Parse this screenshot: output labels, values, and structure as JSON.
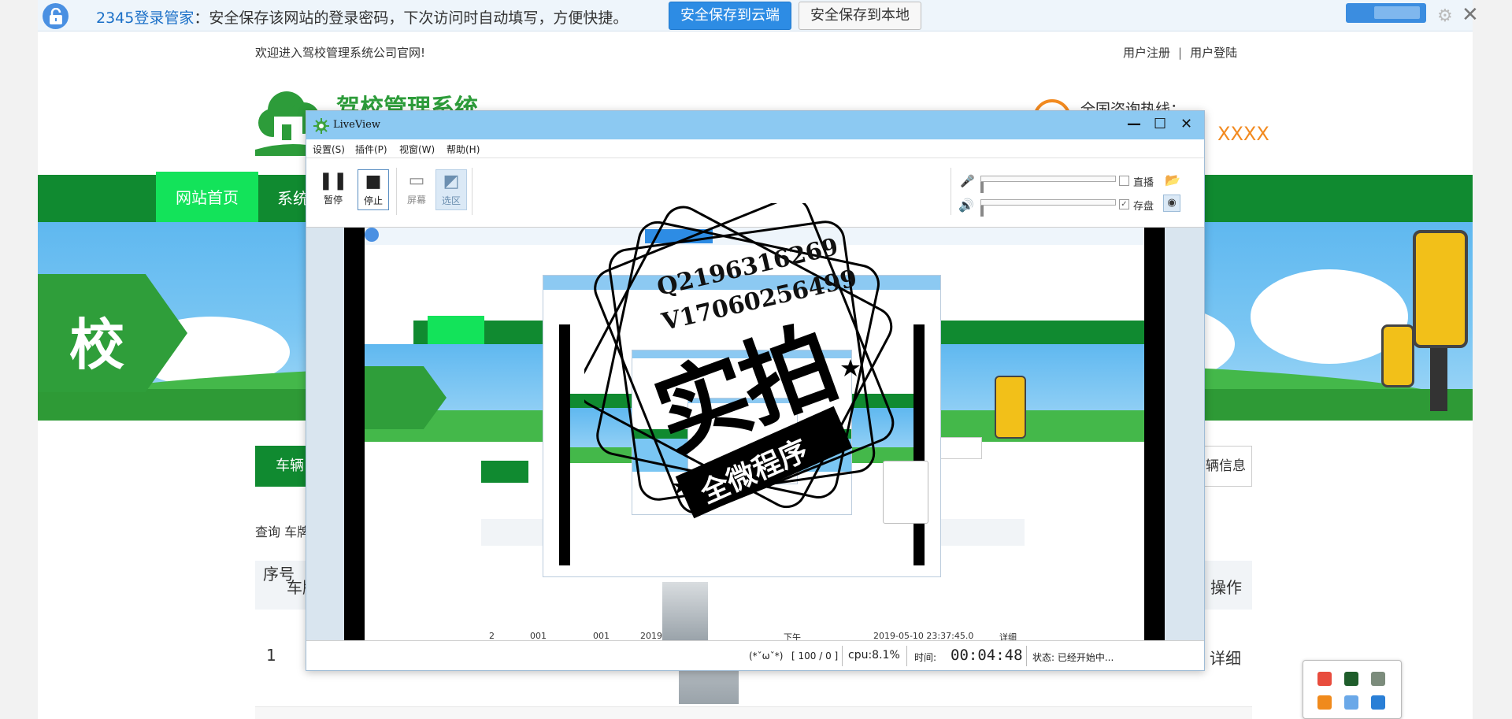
{
  "password_bar": {
    "brand": "2345登录管家",
    "message": "：安全保存该网站的登录密码，下次访问时自动填写，方便快捷。",
    "cloud_button": "安全保存到云端",
    "local_button": "安全保存到本地"
  },
  "site": {
    "welcome": "欢迎进入驾校管理系统公司官网!",
    "register": "用户注册",
    "login": "用户登陆",
    "logo_title": "驾校管理系统",
    "hotline_label": "全国咨询热线：",
    "hotline_number": "XXXX",
    "nav_home": "网站首页",
    "nav_2": "系统",
    "banner_text": "校",
    "category_button": "车辆",
    "info_button": "辆信息",
    "query_text": "查询 车牌",
    "table": {
      "col_index": "序号",
      "col_plate": "车牌",
      "col_action": "操作",
      "row1_index": "1",
      "row1_action": "详细"
    }
  },
  "liveview": {
    "title": "LiveView",
    "window_buttons": [
      "—",
      "☐",
      "✕"
    ],
    "menu": [
      "设置(S)",
      "插件(P)",
      "视窗(W)",
      "帮助(H)"
    ],
    "tools": {
      "pause": "暂停",
      "stop": "停止",
      "screen": "屏幕",
      "region": "选区"
    },
    "audio": {
      "live_label": "直播",
      "save_label": "存盘",
      "save_checked": true,
      "live_checked": false
    },
    "status": {
      "face": "(*ˇωˇ*)",
      "frames": "[ 100 / 0 ]",
      "cpu": "cpu:8.1%",
      "time_label": "时间:",
      "time_value": "00:04:48",
      "state": "状态:  已经开始中..."
    },
    "preview": {
      "row2": [
        "2",
        "001",
        "001",
        "2019-05-10",
        "下午",
        "2019-05-10 23:37:45.0",
        "详细"
      ]
    }
  },
  "watermark": {
    "line1": "Q2196316269",
    "line2": "V17060256499",
    "big": "实拍",
    "ribbon": "全微程序"
  }
}
